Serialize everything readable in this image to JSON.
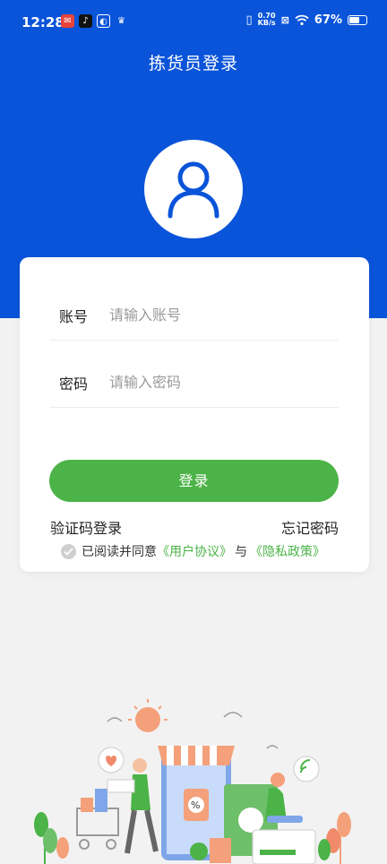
{
  "status_bar": {
    "time": "12:28",
    "net_speed_value": "0.70",
    "net_speed_unit": "KB/s",
    "battery_percent": "67%",
    "battery_level": 0.67
  },
  "header": {
    "title": "拣货员登录"
  },
  "form": {
    "account_label": "账号",
    "account_placeholder": "请输入账号",
    "password_label": "密码",
    "password_placeholder": "请输入密码",
    "login_button": "登录",
    "sms_login_link": "验证码登录",
    "forgot_password_link": "忘记密码"
  },
  "agreement": {
    "prefix": "已阅读并同意",
    "user_agreement": "《用户协议》",
    "and": "与",
    "privacy_policy": "《隐私政策》"
  },
  "colors": {
    "header_bg": "#0a54d9",
    "accent_green": "#4bb347",
    "page_bg": "#f2f2f2"
  }
}
